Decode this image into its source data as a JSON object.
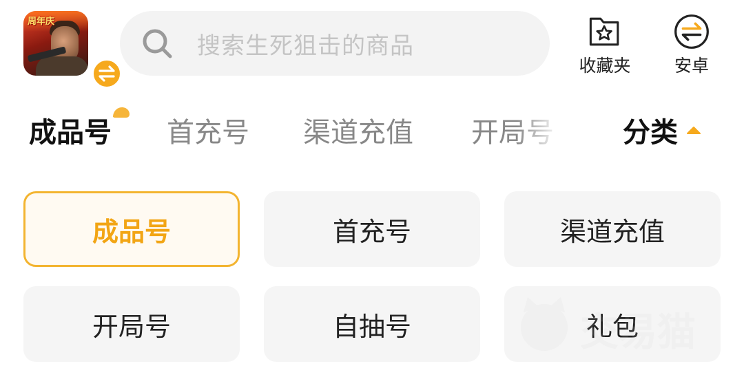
{
  "header": {
    "game_icon": {
      "name": "game-cover-icon",
      "banner_text": "周年庆"
    },
    "switch_badge_icon": "switch-arrows-icon",
    "search": {
      "placeholder": "搜索生死狙击的商品",
      "icon": "search-icon"
    },
    "favorites": {
      "label": "收藏夹",
      "icon": "folder-star-icon"
    },
    "platform": {
      "label": "安卓",
      "icon": "switch-arrows-icon"
    }
  },
  "tabs": {
    "items": [
      {
        "label": "成品号",
        "active": true
      },
      {
        "label": "首充号",
        "active": false
      },
      {
        "label": "渠道充值",
        "active": false
      },
      {
        "label": "开局号",
        "active": false
      }
    ],
    "category_toggle": {
      "label": "分类",
      "icon": "caret-up-icon"
    }
  },
  "grid": {
    "items": [
      {
        "label": "成品号",
        "selected": true
      },
      {
        "label": "首充号",
        "selected": false
      },
      {
        "label": "渠道充值",
        "selected": false
      },
      {
        "label": "开局号",
        "selected": false
      },
      {
        "label": "自抽号",
        "selected": false
      },
      {
        "label": "礼包",
        "selected": false
      }
    ],
    "watermark_text": "交易猫"
  },
  "colors": {
    "accent": "#f6a91d",
    "selected_border": "#f3b430",
    "selected_text": "#f2a515",
    "cell_bg": "#f5f5f5",
    "search_bg": "#f3f3f3"
  }
}
